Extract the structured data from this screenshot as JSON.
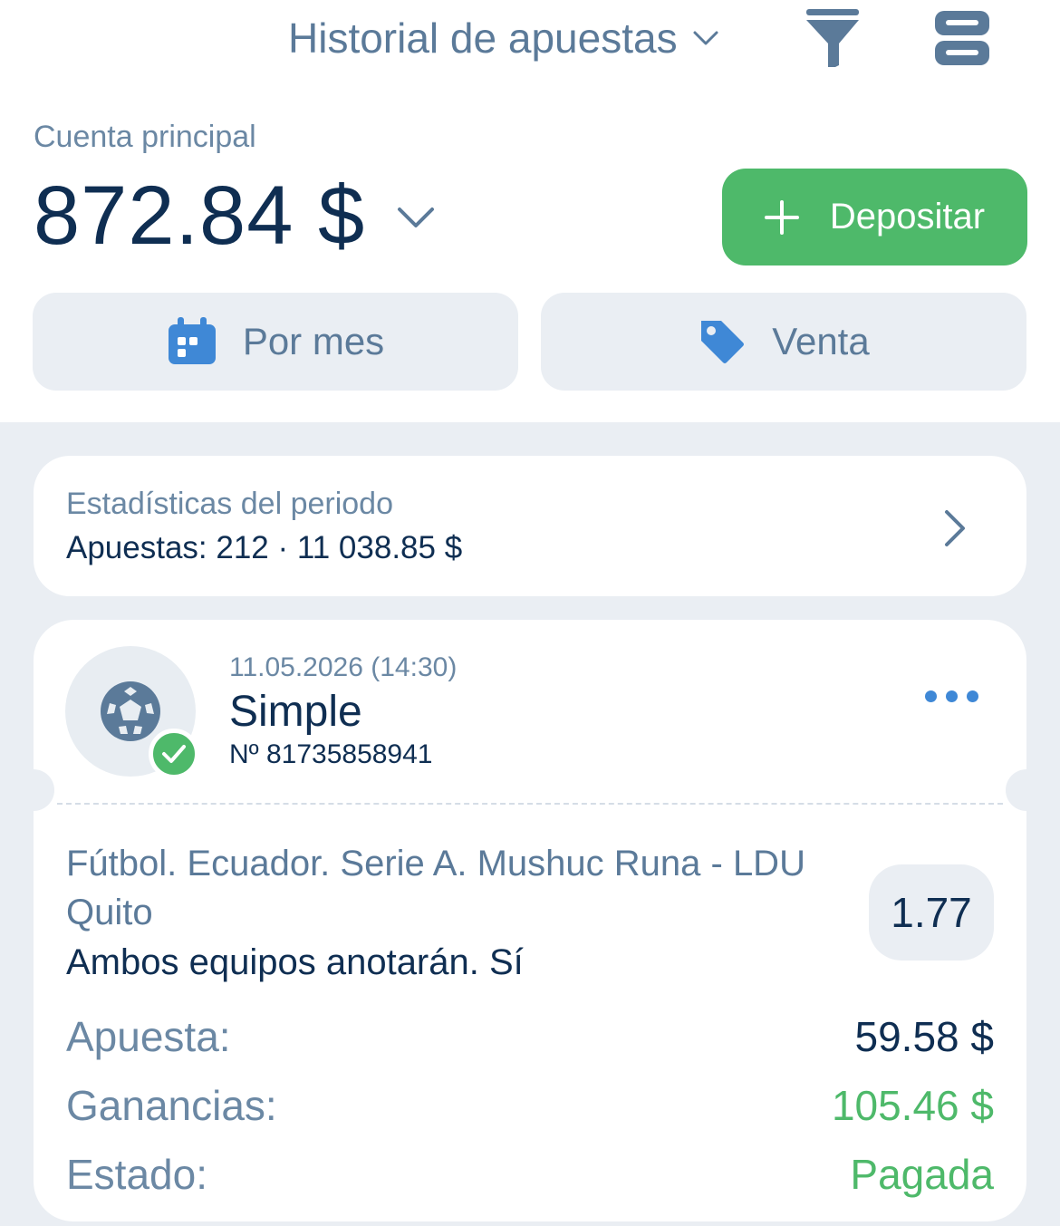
{
  "header": {
    "title": "Historial de apuestas",
    "title_color": "#5b7a99"
  },
  "account": {
    "label": "Cuenta principal",
    "balance": "872.84 $"
  },
  "deposit": {
    "label": "Depositar",
    "color": "#4eb96a"
  },
  "filters": {
    "month_label": "Por mes",
    "sale_label": "Venta"
  },
  "stats": {
    "title": "Estadísticas del periodo",
    "value": "Apuestas: 212 · 11 038.85 $"
  },
  "bet": {
    "date": "11.05.2026 (14:30)",
    "type": "Simple",
    "number": "Nº 81735858941",
    "sport_icon": "soccer-ball-icon",
    "event": "Fútbol. Ecuador. Serie A. Mushuc Runa - LDU Quito",
    "market": "Ambos equipos anotarán. Sí",
    "odds": "1.77",
    "stake_label": "Apuesta:",
    "stake_value": "59.58 $",
    "winnings_label": "Ganancias:",
    "winnings_value": "105.46 $",
    "status_label": "Estado:",
    "status_value": "Pagada",
    "status_color": "#4eb96a"
  },
  "colors": {
    "primary_text": "#0f2e52",
    "secondary_text": "#6b88a4",
    "accent_blue": "#3f88d6",
    "background": "#eaeef3"
  }
}
